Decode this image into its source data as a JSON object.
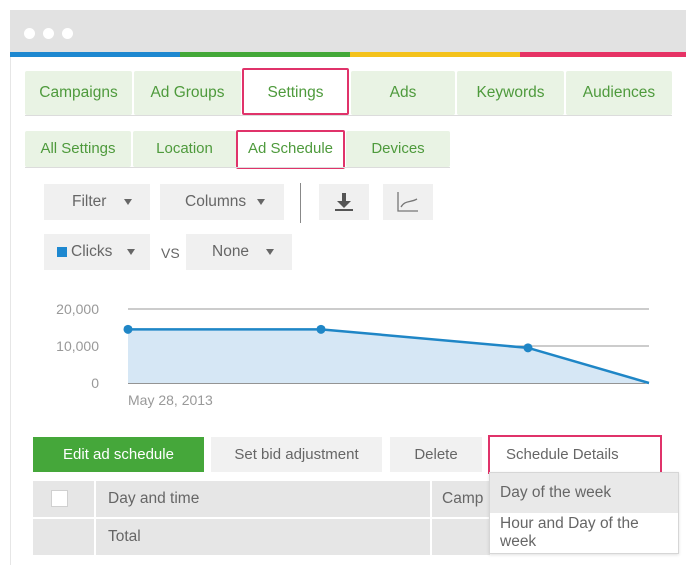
{
  "browser": {
    "chrome_colors": [
      "#1e88d0",
      "#43a838",
      "#f4c21b",
      "#e63265"
    ]
  },
  "nav_tabs": [
    {
      "label": "Campaigns",
      "selected": false
    },
    {
      "label": "Ad Groups",
      "selected": false
    },
    {
      "label": "Settings",
      "selected": true
    },
    {
      "label": "Ads",
      "selected": false
    },
    {
      "label": "Keywords",
      "selected": false
    },
    {
      "label": "Audiences",
      "selected": false
    }
  ],
  "sub_tabs": [
    {
      "label": "All Settings",
      "selected": false
    },
    {
      "label": "Location",
      "selected": false
    },
    {
      "label": "Ad Schedule",
      "selected": true
    },
    {
      "label": "Devices",
      "selected": false
    }
  ],
  "toolbar": {
    "filter_label": "Filter",
    "columns_label": "Columns",
    "download_icon": "download-icon",
    "chart_icon": "line-chart-icon",
    "metric1": "Clicks",
    "metric1_color": "#1e88d0",
    "vs_label": "VS",
    "metric2": "None"
  },
  "chart_data": {
    "type": "area",
    "x": [
      "May 28, 2013",
      "",
      "",
      ""
    ],
    "y_ticks": [
      "20,000",
      "10,000",
      "0"
    ],
    "ylim": [
      0,
      20000
    ],
    "series": [
      {
        "values": [
          14500,
          14500,
          9500,
          0
        ]
      }
    ],
    "xlabel": "May 28, 2013",
    "grid": true,
    "line_color": "#1f86c6",
    "fill_color": "#d6e7f5"
  },
  "actions": {
    "edit_label": "Edit ad schedule",
    "bid_label": "Set bid adjustment",
    "delete_label": "Delete",
    "details_label": "Schedule Details"
  },
  "table": {
    "headers": [
      "Day and time",
      "Camp"
    ],
    "total_label": "Total"
  },
  "dropdown": {
    "items": [
      "Day of the week",
      "Hour and Day of the week"
    ]
  }
}
